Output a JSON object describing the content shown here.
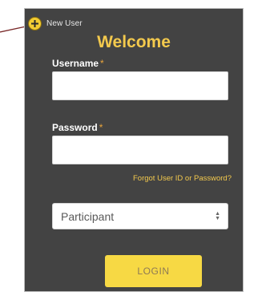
{
  "new_user": {
    "label": "New User",
    "icon": "plus-circle-icon"
  },
  "header": {
    "title": "Welcome"
  },
  "username": {
    "label": "Username",
    "required_mark": "*",
    "value": ""
  },
  "password": {
    "label": "Password",
    "required_mark": "*",
    "value": ""
  },
  "forgot_link": {
    "label": "Forgot User ID or Password?"
  },
  "role_select": {
    "value": "Participant",
    "icon": "updown-arrows-icon"
  },
  "login_button": {
    "label": "LOGIN"
  },
  "colors": {
    "panel_background": "#434343",
    "accent_yellow": "#f3c94d",
    "button_yellow": "#f7d944",
    "button_text": "#8e7a55"
  }
}
